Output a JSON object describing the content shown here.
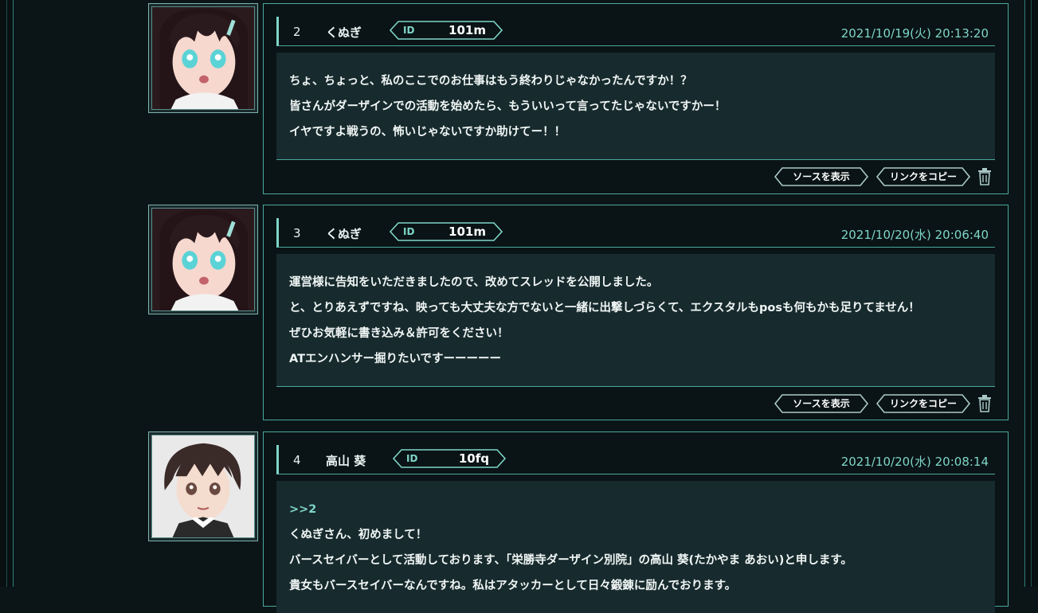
{
  "posts": [
    {
      "num": "2",
      "name": "くぬぎ",
      "id_label": "ID",
      "id": "101m",
      "date": "2021/10/19(火) 20:13:20",
      "lines": [
        "ちょ、ちょっと、私のここでのお仕事はもう終わりじゃなかったんですか！？",
        "皆さんがダーザインでの活動を始めたら、もういいって言ってたじゃないですかー！",
        "イヤですよ戦うの、怖いじゃないですか助けてー！！"
      ],
      "avatar": "kunugi-avatar"
    },
    {
      "num": "3",
      "name": "くぬぎ",
      "id_label": "ID",
      "id": "101m",
      "date": "2021/10/20(水) 20:06:40",
      "lines": [
        "運営様に告知をいただきましたので、改めてスレッドを公開しました。",
        "と、とりあえずですね、映っても大丈夫な方でないと一緒に出撃しづらくて、エクスタルもposも何もかも足りてません！",
        "ぜひお気軽に書き込み＆許可をください！",
        "ATエンハンサー掘りたいですーーーーー"
      ],
      "avatar": "kunugi-avatar"
    },
    {
      "num": "4",
      "name": "高山 葵",
      "id_label": "ID",
      "id": "10fq",
      "date": "2021/10/20(水) 20:08:14",
      "anchor": ">>2",
      "lines": [
        "くぬぎさん、初めまして！",
        "バースセイバーとして活動しております、「栄勝寺ダーザイン別院」の高山 葵(たかやま あおい)と申します。",
        "貴女もバースセイバーなんですね。私はアタッカーとして日々鍛錬に励んでおります。"
      ],
      "avatar": "takayama-avatar"
    }
  ],
  "buttons": {
    "view_source": "ソースを表示",
    "copy_link": "リンクをコピー"
  },
  "icons": {
    "delete": "trash-icon"
  },
  "colors": {
    "accent": "#7ed6c9",
    "border": "#4aa89e",
    "body_bg": "#172a2d",
    "page_bg": "#0b1518"
  }
}
